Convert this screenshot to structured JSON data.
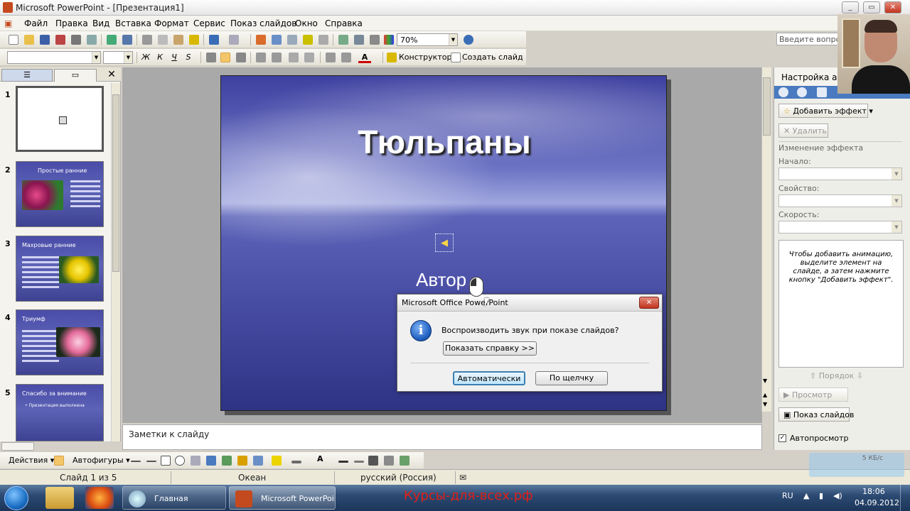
{
  "window": {
    "title": "Microsoft PowerPoint - [Презентация1]"
  },
  "menu": {
    "items": [
      "Файл",
      "Правка",
      "Вид",
      "Вставка",
      "Формат",
      "Сервис",
      "Показ слайдов",
      "Окно",
      "Справка"
    ],
    "help_placeholder": "Введите вопрос"
  },
  "toolbar": {
    "zoom": "70%",
    "designer": "Конструктор",
    "new_slide": "Создать слайд",
    "bold": "Ж",
    "italic": "К",
    "underline": "Ч",
    "shadow": "S",
    "font_color": "A"
  },
  "slides_panel": {
    "numbers": [
      "1",
      "2",
      "3",
      "4",
      "5"
    ],
    "thumb2_title": "Простые ранние",
    "thumb3_title": "Махровые ранние",
    "thumb4_title": "Триумф",
    "thumb5_title": "Спасибо за внимание",
    "thumb5_sub": "• Презентация выполнена"
  },
  "slide": {
    "title": "Тюльпаны",
    "author": "Автор"
  },
  "notes": {
    "placeholder": "Заметки к слайду"
  },
  "task_pane": {
    "title": "Настройка анимации",
    "add_effect": "Добавить эффект",
    "remove": "Удалить",
    "change_effect": "Изменение эффекта",
    "start_label": "Начало:",
    "property_label": "Свойство:",
    "speed_label": "Скорость:",
    "hint": "Чтобы добавить анимацию, выделите элемент на слайде, а затем нажмите кнопку \"Добавить эффект\".",
    "reorder": "Порядок",
    "preview": "Просмотр",
    "slideshow": "Показ слайдов",
    "autopreview": "Автопросмотр"
  },
  "dialog": {
    "title": "Microsoft Office PowerPoint",
    "message": "Воспроизводить звук при показе слайдов?",
    "show_help": "Показать справку >>",
    "auto": "Автоматически",
    "on_click": "По щелчку"
  },
  "drawing": {
    "actions": "Действия",
    "autoshapes": "Автофигуры"
  },
  "status": {
    "slide": "Слайд 1 из 5",
    "design": "Океан",
    "language": "русский (Россия)"
  },
  "taskbar": {
    "task1": "Главная",
    "task2": "Microsoft PowerPoint...",
    "watermark": "Курсы-для-всех.рф",
    "lang": "RU",
    "time": "18:06",
    "date": "04.09.2012",
    "net": "5 КБ/с"
  }
}
